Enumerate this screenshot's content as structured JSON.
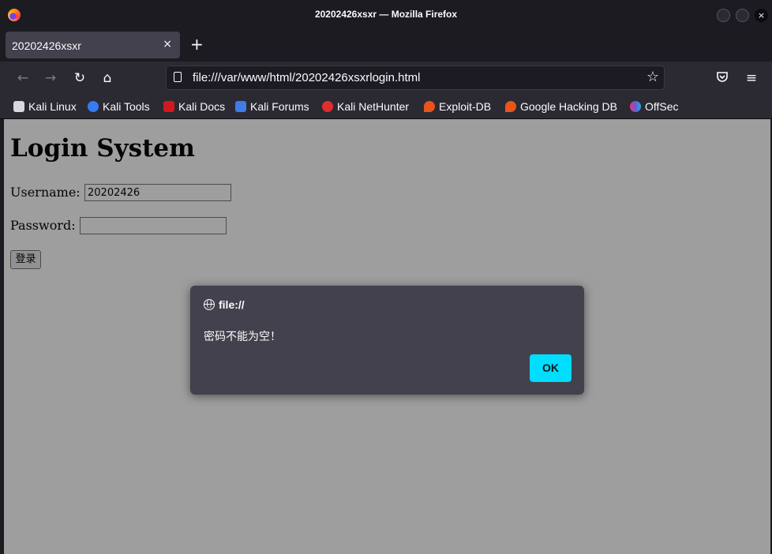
{
  "window": {
    "title": "20202426xsxr — Mozilla Firefox",
    "close_glyph": "×"
  },
  "tabs": [
    {
      "label": "20202426xsxr",
      "close_glyph": "×"
    }
  ],
  "newtab_glyph": "+",
  "nav": {
    "back_glyph": "←",
    "forward_glyph": "→",
    "reload_glyph": "↻",
    "home_glyph": "⌂",
    "url": "file:///var/www/html/20202426xsxrlogin.html",
    "star_glyph": "☆",
    "menu_glyph": "≡"
  },
  "bookmarks": [
    {
      "label": "Kali Linux",
      "icon": "kali-dragon-icon",
      "color": "#2b2a33"
    },
    {
      "label": "Kali Tools",
      "icon": "kali-tools-icon",
      "color": "#367bf0"
    },
    {
      "label": "Kali Docs",
      "icon": "kali-docs-icon",
      "color": "#d3181f"
    },
    {
      "label": "Kali Forums",
      "icon": "kali-forums-icon",
      "color": "#3f7ce8"
    },
    {
      "label": "Kali NetHunter",
      "icon": "nethunter-icon",
      "color": "#e02e2e"
    },
    {
      "label": "Exploit-DB",
      "icon": "exploit-db-icon",
      "color": "#e8541c"
    },
    {
      "label": "Google Hacking DB",
      "icon": "ghdb-icon",
      "color": "#e8541c"
    },
    {
      "label": "OffSec",
      "icon": "offsec-icon",
      "color": "#6a5ad6"
    }
  ],
  "page": {
    "heading": "Login System",
    "username_label": "Username:",
    "username_value": "20202426",
    "password_label": "Password:",
    "password_value": "",
    "submit_label": "登录"
  },
  "dialog": {
    "origin": "file://",
    "message": "密码不能为空！",
    "ok_label": "OK"
  },
  "colors": {
    "chrome_dark": "#1c1b22",
    "toolbar": "#2b2a33",
    "dialog_bg": "#42414d",
    "accent": "#00ddff"
  }
}
